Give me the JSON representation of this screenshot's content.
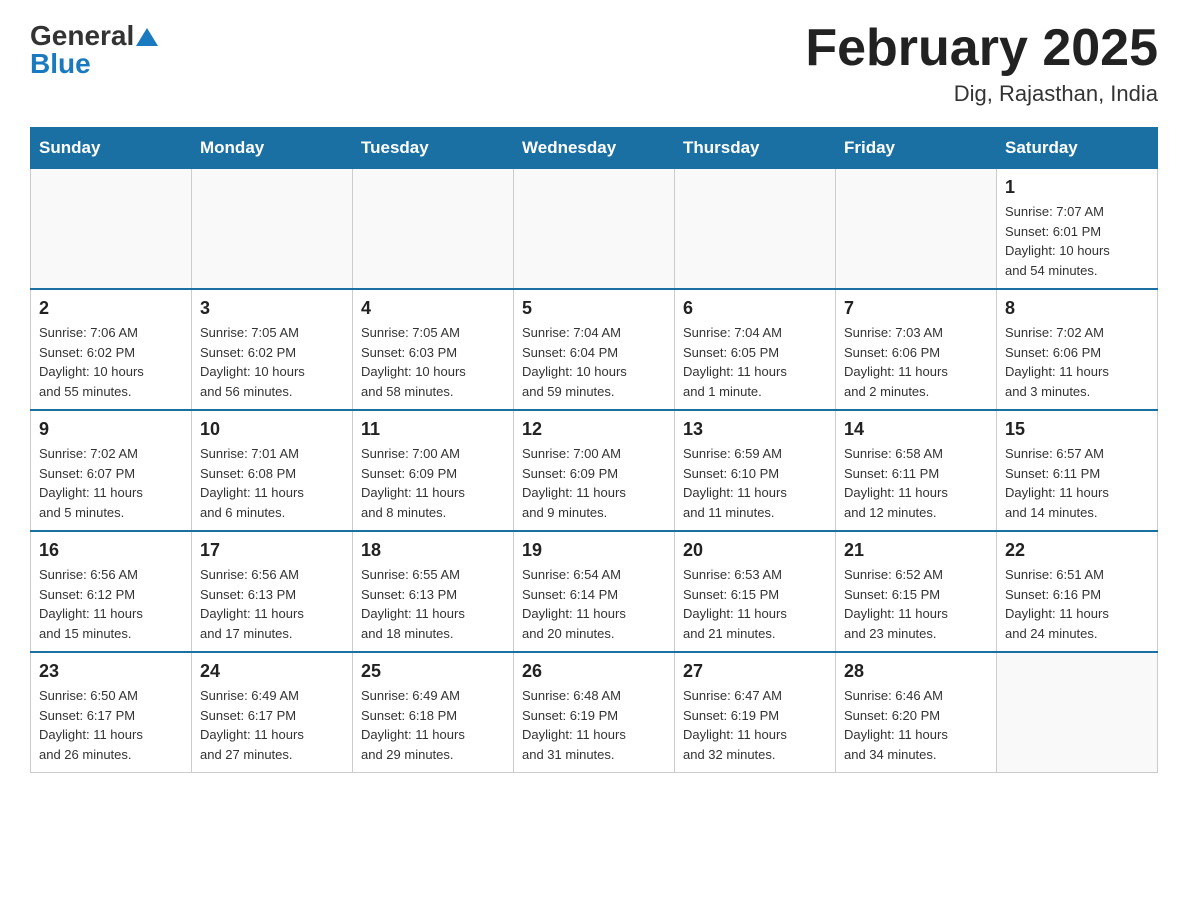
{
  "header": {
    "logo": {
      "general": "General",
      "blue": "Blue"
    },
    "title": "February 2025",
    "location": "Dig, Rajasthan, India"
  },
  "days_of_week": [
    "Sunday",
    "Monday",
    "Tuesday",
    "Wednesday",
    "Thursday",
    "Friday",
    "Saturday"
  ],
  "weeks": [
    [
      {
        "day": "",
        "info": ""
      },
      {
        "day": "",
        "info": ""
      },
      {
        "day": "",
        "info": ""
      },
      {
        "day": "",
        "info": ""
      },
      {
        "day": "",
        "info": ""
      },
      {
        "day": "",
        "info": ""
      },
      {
        "day": "1",
        "info": "Sunrise: 7:07 AM\nSunset: 6:01 PM\nDaylight: 10 hours\nand 54 minutes."
      }
    ],
    [
      {
        "day": "2",
        "info": "Sunrise: 7:06 AM\nSunset: 6:02 PM\nDaylight: 10 hours\nand 55 minutes."
      },
      {
        "day": "3",
        "info": "Sunrise: 7:05 AM\nSunset: 6:02 PM\nDaylight: 10 hours\nand 56 minutes."
      },
      {
        "day": "4",
        "info": "Sunrise: 7:05 AM\nSunset: 6:03 PM\nDaylight: 10 hours\nand 58 minutes."
      },
      {
        "day": "5",
        "info": "Sunrise: 7:04 AM\nSunset: 6:04 PM\nDaylight: 10 hours\nand 59 minutes."
      },
      {
        "day": "6",
        "info": "Sunrise: 7:04 AM\nSunset: 6:05 PM\nDaylight: 11 hours\nand 1 minute."
      },
      {
        "day": "7",
        "info": "Sunrise: 7:03 AM\nSunset: 6:06 PM\nDaylight: 11 hours\nand 2 minutes."
      },
      {
        "day": "8",
        "info": "Sunrise: 7:02 AM\nSunset: 6:06 PM\nDaylight: 11 hours\nand 3 minutes."
      }
    ],
    [
      {
        "day": "9",
        "info": "Sunrise: 7:02 AM\nSunset: 6:07 PM\nDaylight: 11 hours\nand 5 minutes."
      },
      {
        "day": "10",
        "info": "Sunrise: 7:01 AM\nSunset: 6:08 PM\nDaylight: 11 hours\nand 6 minutes."
      },
      {
        "day": "11",
        "info": "Sunrise: 7:00 AM\nSunset: 6:09 PM\nDaylight: 11 hours\nand 8 minutes."
      },
      {
        "day": "12",
        "info": "Sunrise: 7:00 AM\nSunset: 6:09 PM\nDaylight: 11 hours\nand 9 minutes."
      },
      {
        "day": "13",
        "info": "Sunrise: 6:59 AM\nSunset: 6:10 PM\nDaylight: 11 hours\nand 11 minutes."
      },
      {
        "day": "14",
        "info": "Sunrise: 6:58 AM\nSunset: 6:11 PM\nDaylight: 11 hours\nand 12 minutes."
      },
      {
        "day": "15",
        "info": "Sunrise: 6:57 AM\nSunset: 6:11 PM\nDaylight: 11 hours\nand 14 minutes."
      }
    ],
    [
      {
        "day": "16",
        "info": "Sunrise: 6:56 AM\nSunset: 6:12 PM\nDaylight: 11 hours\nand 15 minutes."
      },
      {
        "day": "17",
        "info": "Sunrise: 6:56 AM\nSunset: 6:13 PM\nDaylight: 11 hours\nand 17 minutes."
      },
      {
        "day": "18",
        "info": "Sunrise: 6:55 AM\nSunset: 6:13 PM\nDaylight: 11 hours\nand 18 minutes."
      },
      {
        "day": "19",
        "info": "Sunrise: 6:54 AM\nSunset: 6:14 PM\nDaylight: 11 hours\nand 20 minutes."
      },
      {
        "day": "20",
        "info": "Sunrise: 6:53 AM\nSunset: 6:15 PM\nDaylight: 11 hours\nand 21 minutes."
      },
      {
        "day": "21",
        "info": "Sunrise: 6:52 AM\nSunset: 6:15 PM\nDaylight: 11 hours\nand 23 minutes."
      },
      {
        "day": "22",
        "info": "Sunrise: 6:51 AM\nSunset: 6:16 PM\nDaylight: 11 hours\nand 24 minutes."
      }
    ],
    [
      {
        "day": "23",
        "info": "Sunrise: 6:50 AM\nSunset: 6:17 PM\nDaylight: 11 hours\nand 26 minutes."
      },
      {
        "day": "24",
        "info": "Sunrise: 6:49 AM\nSunset: 6:17 PM\nDaylight: 11 hours\nand 27 minutes."
      },
      {
        "day": "25",
        "info": "Sunrise: 6:49 AM\nSunset: 6:18 PM\nDaylight: 11 hours\nand 29 minutes."
      },
      {
        "day": "26",
        "info": "Sunrise: 6:48 AM\nSunset: 6:19 PM\nDaylight: 11 hours\nand 31 minutes."
      },
      {
        "day": "27",
        "info": "Sunrise: 6:47 AM\nSunset: 6:19 PM\nDaylight: 11 hours\nand 32 minutes."
      },
      {
        "day": "28",
        "info": "Sunrise: 6:46 AM\nSunset: 6:20 PM\nDaylight: 11 hours\nand 34 minutes."
      },
      {
        "day": "",
        "info": ""
      }
    ]
  ]
}
